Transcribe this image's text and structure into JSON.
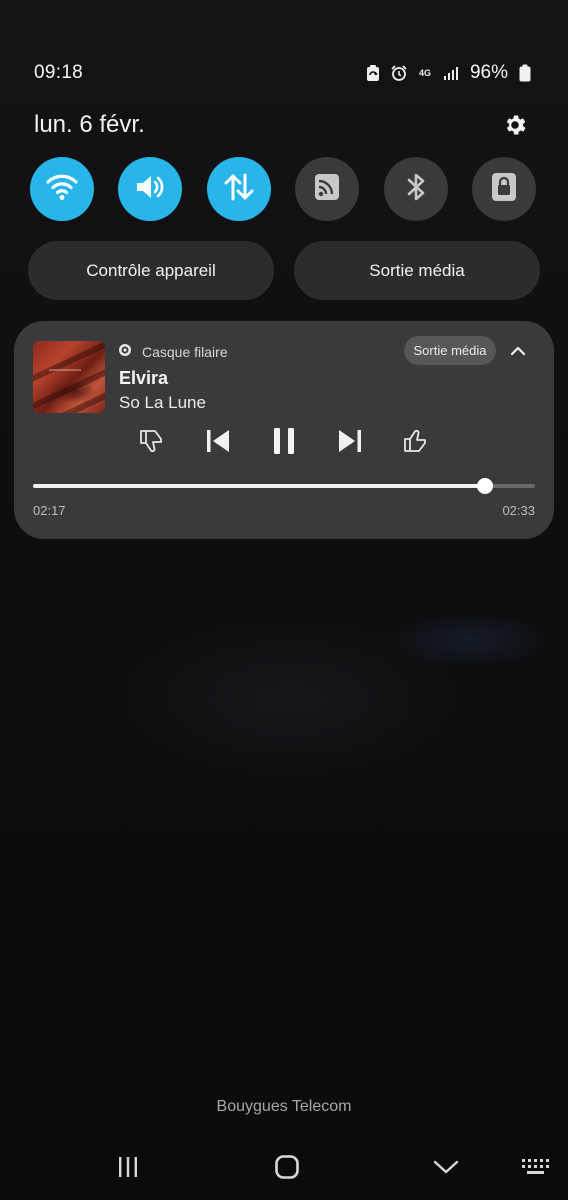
{
  "status_bar": {
    "time": "09:18",
    "battery": "96%",
    "network_type": "4G",
    "icons": [
      "battery-saver-icon",
      "alarm-icon",
      "mobile-data-icon",
      "signal-icon",
      "battery-icon"
    ]
  },
  "header": {
    "date": "lun. 6 févr.",
    "settings_icon": "gear-icon"
  },
  "quick_settings": [
    {
      "name": "wifi",
      "icon": "wifi-icon",
      "active": true
    },
    {
      "name": "sound",
      "icon": "volume-icon",
      "active": true
    },
    {
      "name": "mobile-data",
      "icon": "data-transfer-icon",
      "active": true
    },
    {
      "name": "cast",
      "icon": "cast-icon",
      "active": false
    },
    {
      "name": "bluetooth",
      "icon": "bluetooth-icon",
      "active": false
    },
    {
      "name": "screen-lock",
      "icon": "lock-icon",
      "active": false
    }
  ],
  "pills": {
    "device_control": "Contrôle appareil",
    "media_output": "Sortie média"
  },
  "media": {
    "source": "Casque filaire",
    "output_chip": "Sortie média",
    "title": "Elvira",
    "artist": "So La Lune",
    "elapsed": "02:17",
    "duration": "02:33",
    "progress": 0.9
  },
  "carrier": "Bouygues Telecom",
  "colors": {
    "accent": "#27b5ea",
    "toggle_off": "#3a3a3c",
    "card": "#3a3a3c",
    "pill": "#2c2c2e"
  }
}
